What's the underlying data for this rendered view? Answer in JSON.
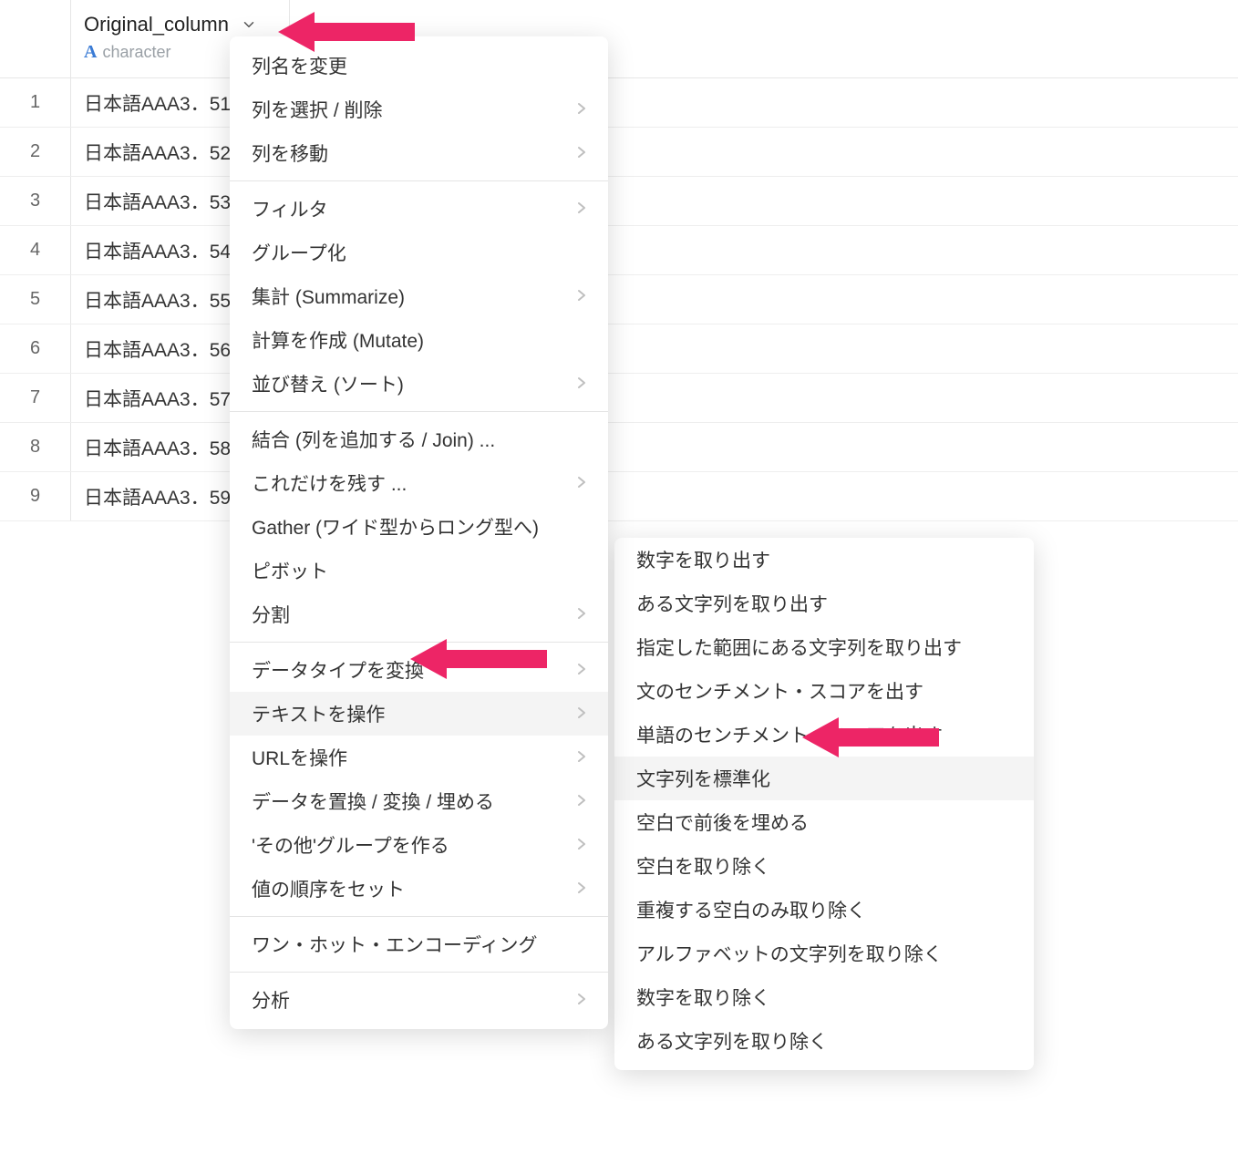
{
  "column": {
    "name": "Original_column",
    "type_label": "character"
  },
  "rows": [
    {
      "n": "1",
      "value": "日本語AAA3．51"
    },
    {
      "n": "2",
      "value": "日本語AAA3．52"
    },
    {
      "n": "3",
      "value": "日本語AAA3．53"
    },
    {
      "n": "4",
      "value": "日本語AAA3．54"
    },
    {
      "n": "5",
      "value": "日本語AAA3．55"
    },
    {
      "n": "6",
      "value": "日本語AAA3．56"
    },
    {
      "n": "7",
      "value": "日本語AAA3．57"
    },
    {
      "n": "8",
      "value": "日本語AAA3．58"
    },
    {
      "n": "9",
      "value": "日本語AAA3．59"
    }
  ],
  "menu": {
    "groups": [
      [
        {
          "label": "列名を変更",
          "sub": false
        },
        {
          "label": "列を選択 / 削除",
          "sub": true
        },
        {
          "label": "列を移動",
          "sub": true
        }
      ],
      [
        {
          "label": "フィルタ",
          "sub": true
        },
        {
          "label": "グループ化",
          "sub": false
        },
        {
          "label": "集計 (Summarize)",
          "sub": true
        },
        {
          "label": "計算を作成 (Mutate)",
          "sub": false
        },
        {
          "label": "並び替え (ソート)",
          "sub": true
        }
      ],
      [
        {
          "label": "結合 (列を追加する / Join) ...",
          "sub": false
        },
        {
          "label": "これだけを残す ...",
          "sub": true
        },
        {
          "label": "Gather (ワイド型からロング型へ)",
          "sub": false
        },
        {
          "label": "ピボット",
          "sub": false
        },
        {
          "label": "分割",
          "sub": true
        }
      ],
      [
        {
          "label": "データタイプを変換",
          "sub": true
        },
        {
          "label": "テキストを操作",
          "sub": true,
          "hover": true
        },
        {
          "label": "URLを操作",
          "sub": true
        },
        {
          "label": "データを置換 / 変換 / 埋める",
          "sub": true
        },
        {
          "label": "'その他'グループを作る",
          "sub": true
        },
        {
          "label": "値の順序をセット",
          "sub": true
        }
      ],
      [
        {
          "label": "ワン・ホット・エンコーディング",
          "sub": false
        }
      ],
      [
        {
          "label": "分析",
          "sub": true
        }
      ]
    ]
  },
  "submenu": {
    "items": [
      {
        "label": "数字を取り出す"
      },
      {
        "label": "ある文字列を取り出す"
      },
      {
        "label": "指定した範囲にある文字列を取り出す"
      },
      {
        "label": "文のセンチメント・スコアを出す"
      },
      {
        "label": "単語のセンチメント・スコアを出す"
      },
      {
        "label": "文字列を標準化",
        "hover": true
      },
      {
        "label": "空白で前後を埋める"
      },
      {
        "label": "空白を取り除く"
      },
      {
        "label": "重複する空白のみ取り除く"
      },
      {
        "label": "アルファベットの文字列を取り除く"
      },
      {
        "label": "数字を取り除く"
      },
      {
        "label": "ある文字列を取り除く"
      }
    ]
  }
}
